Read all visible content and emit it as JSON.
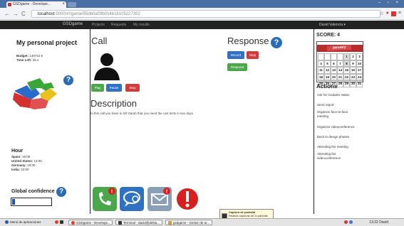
{
  "browser": {
    "tab_title": "GSDgame - Develope...",
    "url_host": "localhost",
    "url_rest": ":9000/#!/game/55db0af3fb014b18105227352",
    "nav_back": "←",
    "nav_forward": "→",
    "nav_reload": "C"
  },
  "navbar": {
    "brand": "GSDgame",
    "links": [
      "Projects",
      "Requests",
      "My results"
    ],
    "user": "David Valencia ▾"
  },
  "left": {
    "project_title": "My personal project",
    "budget_label": "Budget:",
    "budget_value": "140712 €",
    "time_label": "Time Left:",
    "time_value": "25 s",
    "help_glyph": "?",
    "hour_title": "Hour",
    "hours": [
      {
        "place": "Spain:",
        "time": "19:00"
      },
      {
        "place": "United States:",
        "time": "13:00"
      },
      {
        "place": "Germany:",
        "time": "19:00"
      },
      {
        "place": "India:",
        "time": "22:00"
      }
    ],
    "confidence_title": "Global confidence",
    "confidence_help": "?",
    "confidence_level": 0.07
  },
  "call": {
    "title": "Call",
    "buttons": [
      "Play",
      "Pause",
      "Stop"
    ],
    "description_title": "Description",
    "description_text": "In this call you have to tell Sarah that you need the unit tests in two days"
  },
  "response": {
    "title": "Response",
    "help": "?",
    "record": "Record",
    "stop": "Stop",
    "respond": "Respond"
  },
  "tiles": [
    {
      "name": "phone-call-icon",
      "color": "#4aa84a"
    },
    {
      "name": "chat-icon",
      "color": "#2f72c4"
    },
    {
      "name": "email-icon",
      "color": "#8aa0b8"
    },
    {
      "name": "alert-icon",
      "color": "#d92020"
    }
  ],
  "right": {
    "score_label": "SCORE: 4",
    "calendar_month": "January",
    "calendar_days": [
      "",
      "",
      "",
      "",
      "1",
      "2",
      "3",
      "4",
      "5",
      "6",
      "7",
      "8",
      "9",
      "10",
      "11",
      "12",
      "13",
      "14",
      "15",
      "16",
      "17",
      "18",
      "19",
      "20",
      "21",
      "22",
      "23",
      "24",
      "25",
      "26",
      "27",
      "28",
      "29",
      "30",
      "31"
    ],
    "actions_title": "Actions",
    "actions": [
      "Ask for modules status",
      "Send report",
      "Organize face-to-face meeting",
      "Organize videoconference",
      "Back to design phases",
      "Attending the meeting",
      "Attending the videoconference"
    ]
  },
  "taskbar": {
    "menu": "Menú de aplicaciones",
    "items": [
      "GSDgame - Develope...",
      "Terminal - david@debia...",
      "gsdgame - Gestor de ar..."
    ],
    "time": "13:22",
    "user": "David"
  },
  "toast": {
    "title": "Captura de pantalla",
    "body": "Realiza capturas de la pantalla completa, de la ventana activa o de una zona"
  },
  "colors": {
    "accent_blue": "#2f72c4",
    "play_green": "#4aa84a",
    "stop_red": "#d03c3c",
    "navbar": "#222222"
  }
}
